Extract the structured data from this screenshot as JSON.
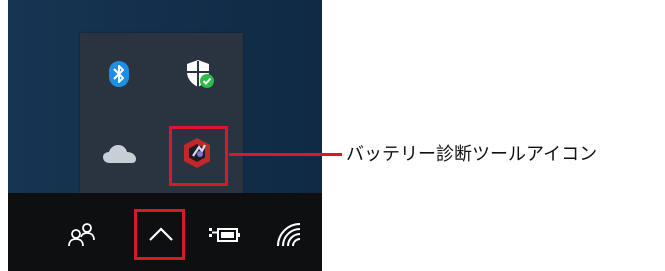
{
  "callout": {
    "label": "バッテリー診断ツールアイコン",
    "highlight_color": "#d7192a"
  },
  "overflow_tray": {
    "icons": [
      {
        "name": "bluetooth-icon",
        "color": "#1a8fe3"
      },
      {
        "name": "windows-security-icon",
        "status": "ok",
        "status_color": "#2dbb4c"
      },
      {
        "name": "onedrive-icon"
      },
      {
        "name": "battery-diagnostic-tool-icon",
        "highlighted": true
      }
    ]
  },
  "taskbar": {
    "icons": [
      {
        "name": "people-icon"
      },
      {
        "name": "show-hidden-icons-chevron-icon",
        "highlighted": true
      },
      {
        "name": "power-battery-icon"
      },
      {
        "name": "wifi-network-icon"
      }
    ]
  }
}
